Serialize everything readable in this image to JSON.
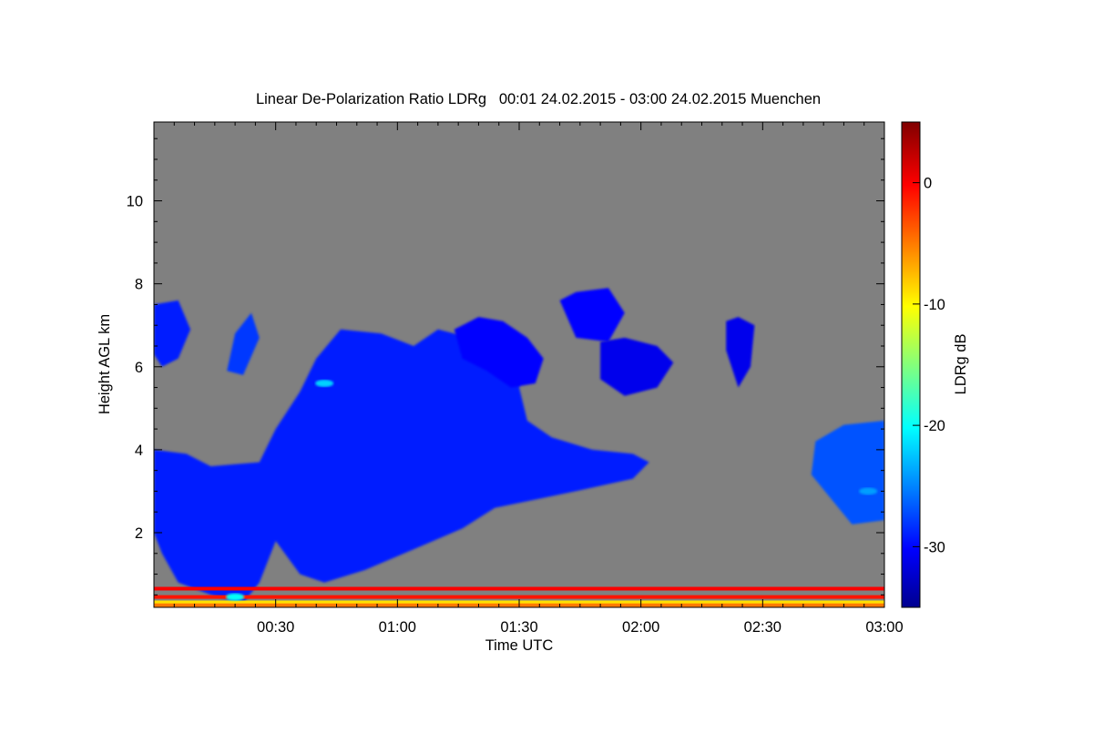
{
  "chart_data": {
    "type": "heatmap",
    "title": "Linear De-Polarization Ratio LDRg   00:01 24.02.2015 - 03:00 24.02.2015 Muenchen",
    "xlabel": "Time UTC",
    "ylabel": "Height AGL km",
    "xlim_minutes": [
      0,
      180
    ],
    "ylim_km": [
      0.2,
      11.9
    ],
    "x_ticks": [
      {
        "minutes": 30,
        "label": "00:30"
      },
      {
        "minutes": 60,
        "label": "01:00"
      },
      {
        "minutes": 90,
        "label": "01:30"
      },
      {
        "minutes": 120,
        "label": "02:00"
      },
      {
        "minutes": 150,
        "label": "02:30"
      },
      {
        "minutes": 180,
        "label": "03:00"
      }
    ],
    "y_ticks": [
      {
        "km": 2,
        "label": "2"
      },
      {
        "km": 4,
        "label": "4"
      },
      {
        "km": 6,
        "label": "6"
      },
      {
        "km": 8,
        "label": "8"
      },
      {
        "km": 10,
        "label": "10"
      }
    ],
    "colorbar": {
      "label": "LDRg dB",
      "range": [
        -35,
        5
      ],
      "ticks": [
        {
          "value": 0,
          "label": "0"
        },
        {
          "value": -10,
          "label": "-10"
        },
        {
          "value": -20,
          "label": "-20"
        },
        {
          "value": -30,
          "label": "-30"
        }
      ],
      "colormap": [
        "#00008f",
        "#0000ff",
        "#00ffff",
        "#ffff00",
        "#ff0000",
        "#800000"
      ]
    },
    "background_color": "#808080",
    "regions": [
      {
        "name": "low-level cloud mass",
        "ldr_db": -29,
        "polygon": [
          [
            0,
            4.0
          ],
          [
            8,
            3.9
          ],
          [
            14,
            3.6
          ],
          [
            26,
            3.7
          ],
          [
            30,
            4.5
          ],
          [
            36,
            5.4
          ],
          [
            40,
            6.2
          ],
          [
            46,
            6.9
          ],
          [
            56,
            6.8
          ],
          [
            64,
            6.5
          ],
          [
            70,
            6.9
          ],
          [
            78,
            6.7
          ],
          [
            86,
            6.8
          ],
          [
            92,
            6.2
          ],
          [
            90,
            5.5
          ],
          [
            92,
            4.7
          ],
          [
            98,
            4.3
          ],
          [
            108,
            4.0
          ],
          [
            118,
            3.9
          ],
          [
            122,
            3.7
          ],
          [
            118,
            3.3
          ],
          [
            104,
            3.0
          ],
          [
            94,
            2.8
          ],
          [
            84,
            2.6
          ],
          [
            76,
            2.1
          ],
          [
            64,
            1.6
          ],
          [
            52,
            1.1
          ],
          [
            42,
            0.8
          ],
          [
            36,
            1.0
          ],
          [
            30,
            1.8
          ],
          [
            26,
            0.8
          ],
          [
            22,
            0.3
          ],
          [
            14,
            0.5
          ],
          [
            6,
            0.8
          ],
          [
            2,
            1.5
          ],
          [
            0,
            2.0
          ]
        ]
      },
      {
        "name": "upper cloud band",
        "ldr_db": -30,
        "polygon": [
          [
            74,
            6.9
          ],
          [
            80,
            7.2
          ],
          [
            86,
            7.1
          ],
          [
            92,
            6.7
          ],
          [
            96,
            6.2
          ],
          [
            94,
            5.6
          ],
          [
            88,
            5.5
          ],
          [
            82,
            5.9
          ],
          [
            76,
            6.2
          ]
        ]
      },
      {
        "name": "upper left patch",
        "ldr_db": -29,
        "polygon": [
          [
            0,
            7.5
          ],
          [
            6,
            7.6
          ],
          [
            9,
            6.9
          ],
          [
            6,
            6.2
          ],
          [
            2,
            6.0
          ],
          [
            0,
            6.3
          ]
        ]
      },
      {
        "name": "upper left small patch",
        "ldr_db": -28,
        "polygon": [
          [
            18,
            5.9
          ],
          [
            20,
            6.8
          ],
          [
            24,
            7.3
          ],
          [
            26,
            6.7
          ],
          [
            22,
            5.8
          ]
        ]
      },
      {
        "name": "upper mid patch",
        "ldr_db": -30,
        "polygon": [
          [
            100,
            7.6
          ],
          [
            104,
            7.8
          ],
          [
            112,
            7.9
          ],
          [
            116,
            7.3
          ],
          [
            112,
            6.6
          ],
          [
            104,
            6.7
          ]
        ]
      },
      {
        "name": "mid-right patch",
        "ldr_db": -31,
        "polygon": [
          [
            110,
            6.6
          ],
          [
            116,
            6.7
          ],
          [
            124,
            6.5
          ],
          [
            128,
            6.1
          ],
          [
            124,
            5.5
          ],
          [
            116,
            5.3
          ],
          [
            110,
            5.7
          ]
        ]
      },
      {
        "name": "right small cell",
        "ldr_db": -31,
        "polygon": [
          [
            141,
            7.1
          ],
          [
            144,
            7.2
          ],
          [
            148,
            7.0
          ],
          [
            147,
            6.0
          ],
          [
            144,
            5.5
          ],
          [
            141,
            6.4
          ]
        ]
      },
      {
        "name": "far right cloud",
        "ldr_db": -27,
        "polygon": [
          [
            163,
            4.2
          ],
          [
            170,
            4.6
          ],
          [
            180,
            4.7
          ],
          [
            180,
            2.3
          ],
          [
            172,
            2.2
          ],
          [
            167,
            2.8
          ],
          [
            162,
            3.4
          ]
        ]
      }
    ],
    "bright_spots": [
      {
        "name": "enhanced LDR near 00:42",
        "x_minutes": 42,
        "y_km": 5.6,
        "ldr_db": -22
      },
      {
        "name": "enhanced LDR near ground 00:20",
        "x_minutes": 20,
        "y_km": 0.45,
        "ldr_db": -20
      },
      {
        "name": "enhanced LDR far right",
        "x_minutes": 176,
        "y_km": 3.0,
        "ldr_db": -24
      }
    ],
    "ground_layers": [
      {
        "name": "surface clutter red line",
        "y_km": 0.65,
        "ldr_db": 0
      },
      {
        "name": "surface clutter red line 2",
        "y_km": 0.45,
        "ldr_db": -1
      },
      {
        "name": "surface clutter yellow line",
        "y_km": 0.32,
        "ldr_db": -9
      },
      {
        "name": "surface clutter orange line",
        "y_km": 0.25,
        "ldr_db": -5
      }
    ]
  }
}
